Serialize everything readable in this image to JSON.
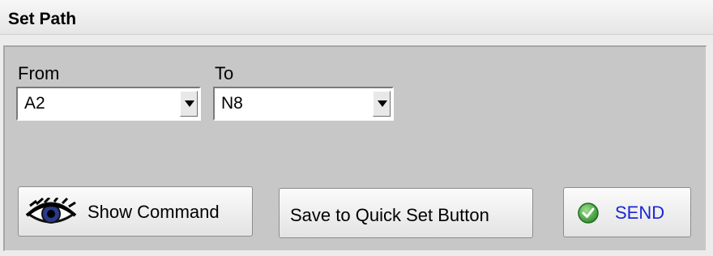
{
  "window": {
    "title": "Set Path"
  },
  "from": {
    "label": "From",
    "value": "A2"
  },
  "to": {
    "label": "To",
    "value": "N8"
  },
  "buttons": {
    "show_command": {
      "label": "Show Command",
      "icon": "eye-icon"
    },
    "save_quick_set": {
      "label": "Save to Quick Set Button"
    },
    "send": {
      "label": "SEND",
      "icon": "check-circle-icon",
      "color": "#1c25d6"
    }
  }
}
